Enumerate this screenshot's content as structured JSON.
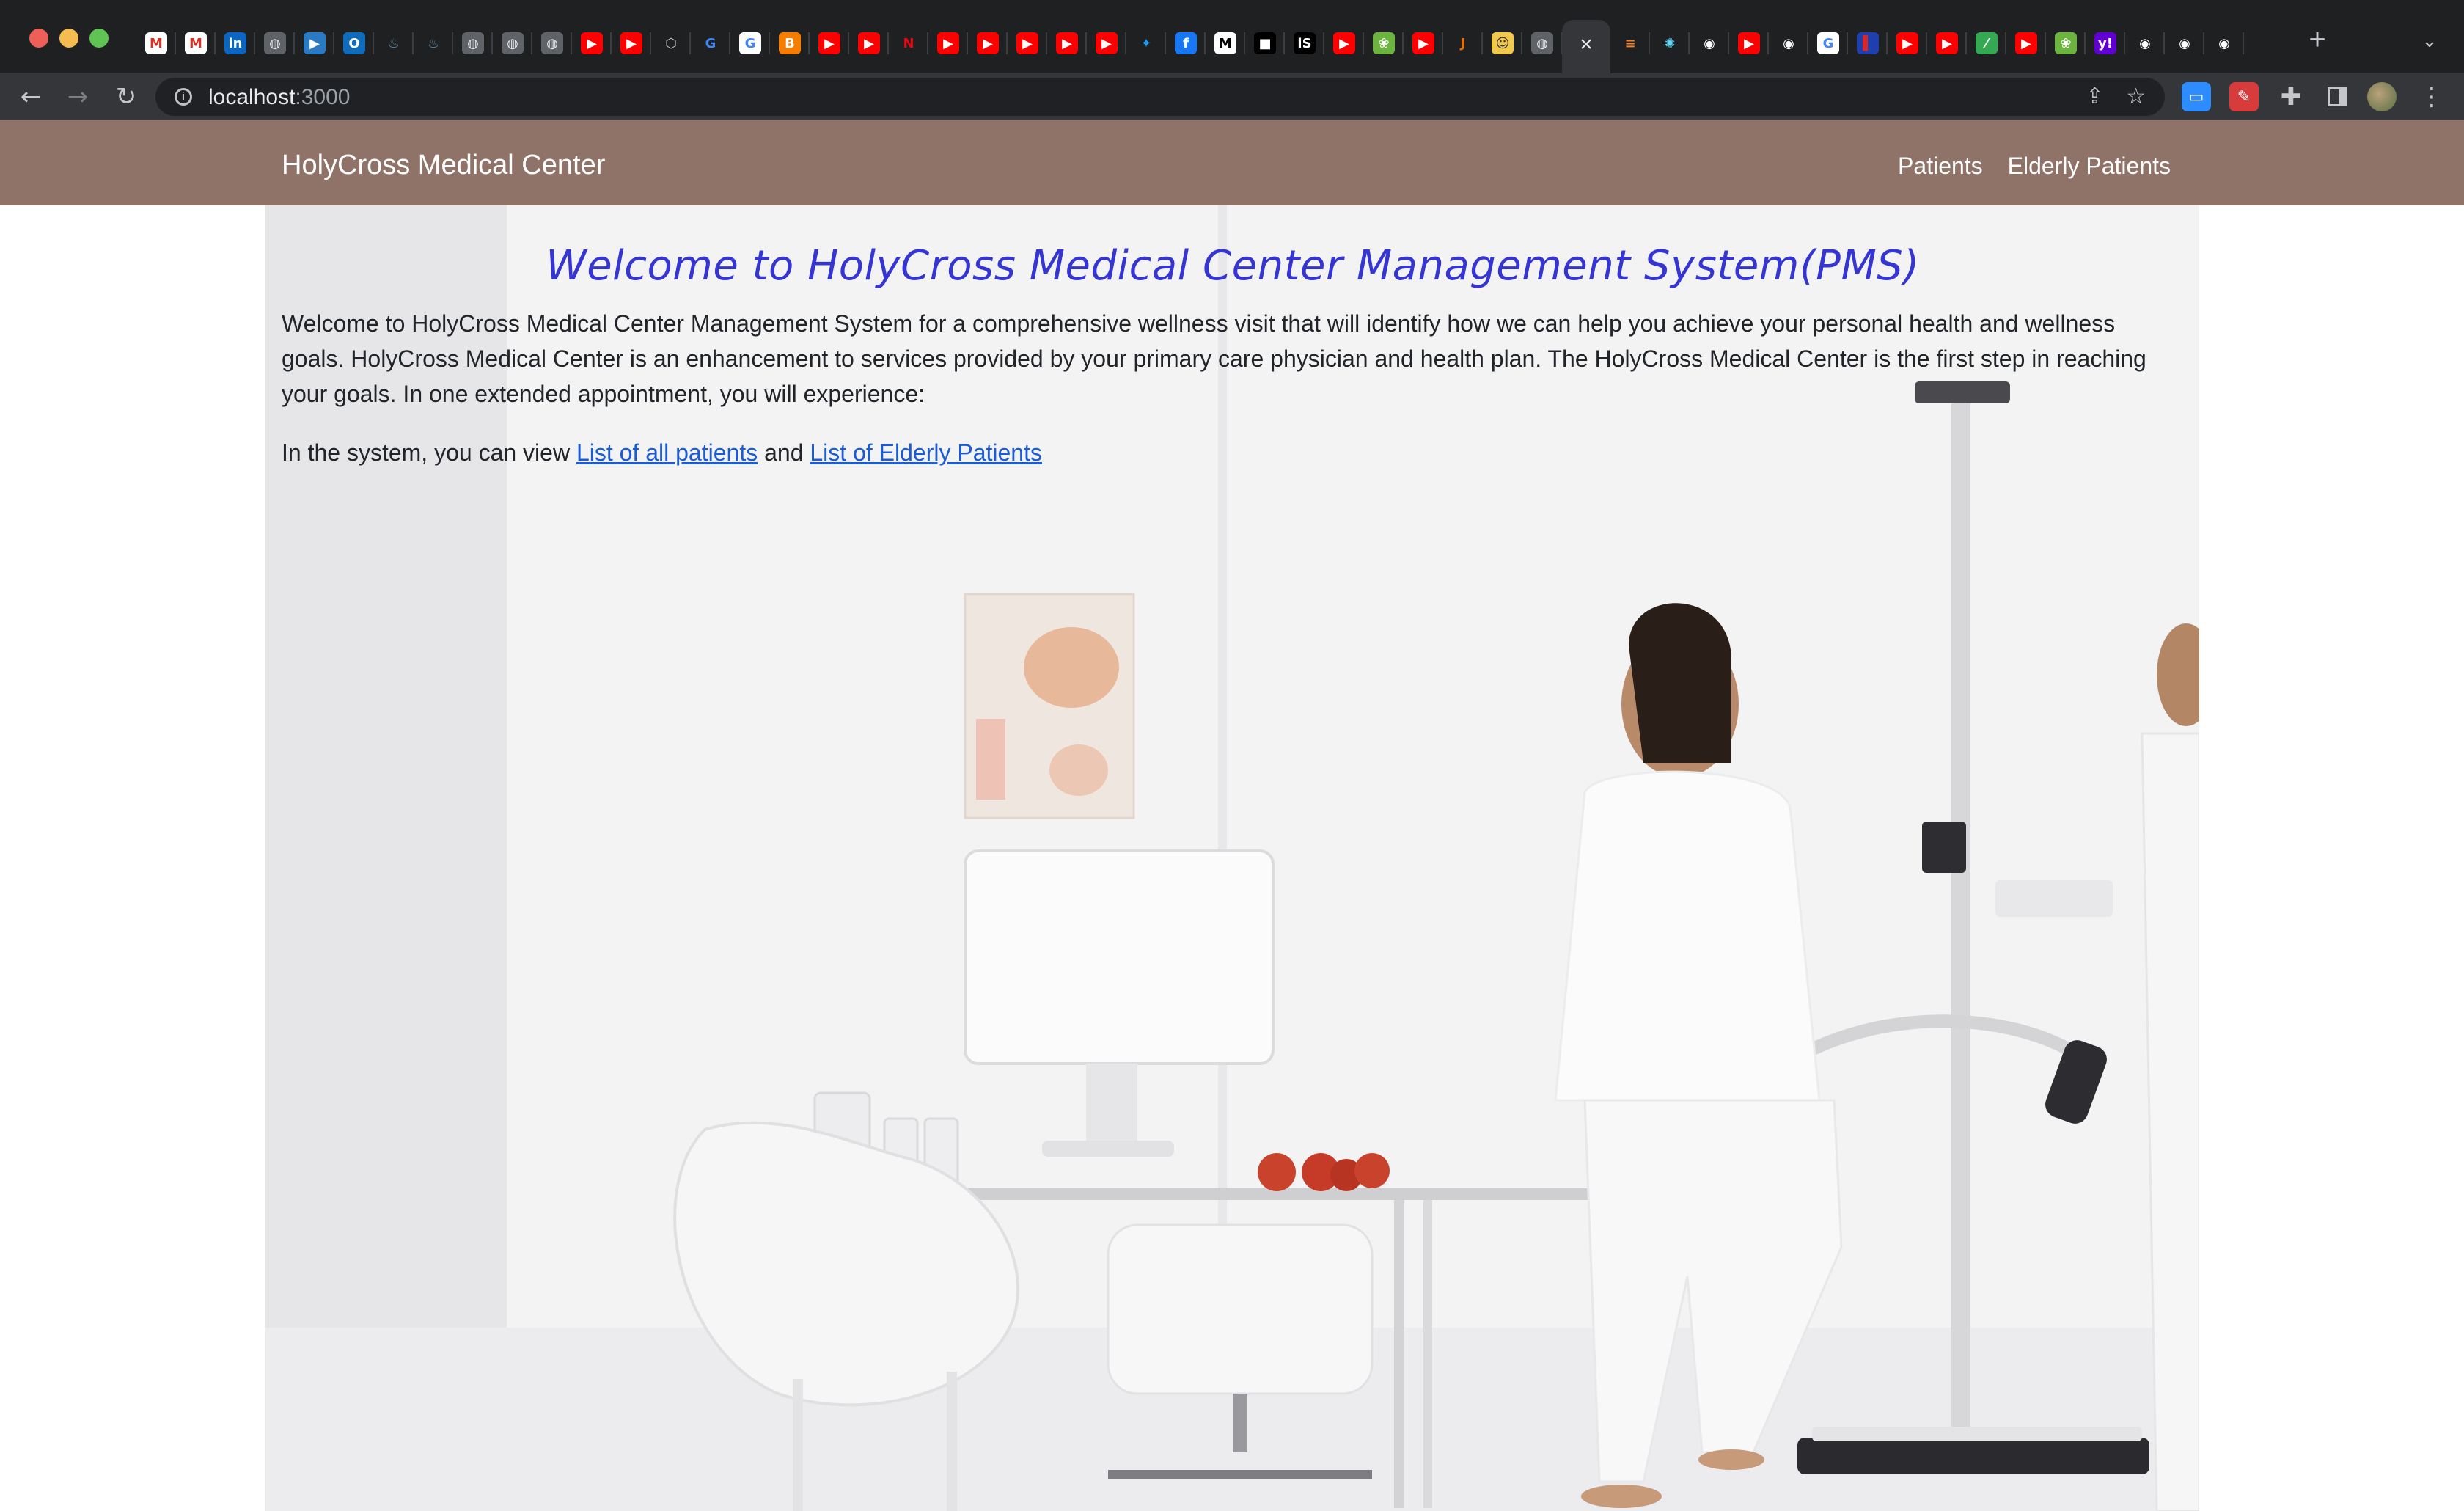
{
  "browser": {
    "url_host": "localhost",
    "url_port": ":3000",
    "colors": {
      "tabstrip": "#1f2022",
      "toolbar": "#35363a",
      "omnibox": "#202124"
    },
    "tab_favicons": [
      {
        "icon": "gmail-icon",
        "bg": "#ffffff",
        "fg": "#d93025",
        "glyph": "M"
      },
      {
        "icon": "gmail-icon",
        "bg": "#ffffff",
        "fg": "#d93025",
        "glyph": "M"
      },
      {
        "icon": "linkedin-icon",
        "bg": "#0a66c2",
        "fg": "#ffffff",
        "glyph": "in"
      },
      {
        "icon": "globe-icon",
        "bg": "#5f6368",
        "fg": "#e8eaed",
        "glyph": "◍"
      },
      {
        "icon": "video-icon",
        "bg": "#2b7bc4",
        "fg": "#ffffff",
        "glyph": "▶"
      },
      {
        "icon": "outlook-icon",
        "bg": "#0f6cbd",
        "fg": "#ffffff",
        "glyph": "O"
      },
      {
        "icon": "java-icon",
        "bg": "#1f2022",
        "fg": "#5382a1",
        "glyph": "♨"
      },
      {
        "icon": "java-icon",
        "bg": "#1f2022",
        "fg": "#5382a1",
        "glyph": "♨"
      },
      {
        "icon": "globe-icon",
        "bg": "#5f6368",
        "fg": "#e8eaed",
        "glyph": "◍"
      },
      {
        "icon": "globe-icon",
        "bg": "#5f6368",
        "fg": "#e8eaed",
        "glyph": "◍"
      },
      {
        "icon": "globe-icon",
        "bg": "#5f6368",
        "fg": "#e8eaed",
        "glyph": "◍"
      },
      {
        "icon": "youtube-icon",
        "bg": "#ff0000",
        "fg": "#ffffff",
        "glyph": "▶"
      },
      {
        "icon": "youtube-icon",
        "bg": "#ff0000",
        "fg": "#ffffff",
        "glyph": "▶"
      },
      {
        "icon": "box-icon",
        "bg": "#1f2022",
        "fg": "#bdbdbd",
        "glyph": "⬡"
      },
      {
        "icon": "google-icon",
        "bg": "#1f2022",
        "fg": "#4285f4",
        "glyph": "G"
      },
      {
        "icon": "google-icon",
        "bg": "#ffffff",
        "fg": "#4285f4",
        "glyph": "G"
      },
      {
        "icon": "blogger-icon",
        "bg": "#f57d00",
        "fg": "#ffffff",
        "glyph": "B"
      },
      {
        "icon": "youtube-icon",
        "bg": "#ff0000",
        "fg": "#ffffff",
        "glyph": "▶"
      },
      {
        "icon": "youtube-icon",
        "bg": "#ff0000",
        "fg": "#ffffff",
        "glyph": "▶"
      },
      {
        "icon": "netflix-icon",
        "bg": "#1f2022",
        "fg": "#e50914",
        "glyph": "N"
      },
      {
        "icon": "youtube-icon",
        "bg": "#ff0000",
        "fg": "#ffffff",
        "glyph": "▶"
      },
      {
        "icon": "youtube-icon",
        "bg": "#ff0000",
        "fg": "#ffffff",
        "glyph": "▶"
      },
      {
        "icon": "youtube-icon",
        "bg": "#ff0000",
        "fg": "#ffffff",
        "glyph": "▶"
      },
      {
        "icon": "youtube-icon",
        "bg": "#ff0000",
        "fg": "#ffffff",
        "glyph": "▶"
      },
      {
        "icon": "youtube-icon",
        "bg": "#ff0000",
        "fg": "#ffffff",
        "glyph": "▶"
      },
      {
        "icon": "twitter-icon",
        "bg": "#1f2022",
        "fg": "#1d9bf0",
        "glyph": "✦"
      },
      {
        "icon": "facebook-icon",
        "bg": "#1877f2",
        "fg": "#ffffff",
        "glyph": "f"
      },
      {
        "icon": "medium-icon",
        "bg": "#ffffff",
        "fg": "#000000",
        "glyph": "M"
      },
      {
        "icon": "dark-icon",
        "bg": "#000000",
        "fg": "#ffffff",
        "glyph": "■"
      },
      {
        "icon": "is-icon",
        "bg": "#000000",
        "fg": "#ffffff",
        "glyph": "iS"
      },
      {
        "icon": "youtube-icon",
        "bg": "#ff0000",
        "fg": "#ffffff",
        "glyph": "▶"
      },
      {
        "icon": "spring-icon",
        "bg": "#6db33f",
        "fg": "#ffffff",
        "glyph": "❀"
      },
      {
        "icon": "youtube-icon",
        "bg": "#ff0000",
        "fg": "#ffffff",
        "glyph": "▶"
      },
      {
        "icon": "java-icon",
        "bg": "#1f2022",
        "fg": "#e76f00",
        "glyph": "J"
      },
      {
        "icon": "emoji-icon",
        "bg": "#f2c94c",
        "fg": "#333333",
        "glyph": "☺"
      },
      {
        "icon": "globe-icon",
        "bg": "#5f6368",
        "fg": "#e8eaed",
        "glyph": "◍"
      }
    ],
    "tab_favicons_after": [
      {
        "icon": "stackoverflow-icon",
        "bg": "#1f2022",
        "fg": "#f48024",
        "glyph": "≡"
      },
      {
        "icon": "react-icon",
        "bg": "#1f2022",
        "fg": "#61dafb",
        "glyph": "✺"
      },
      {
        "icon": "github-icon",
        "bg": "#1f2022",
        "fg": "#ffffff",
        "glyph": "◉"
      },
      {
        "icon": "youtube-icon",
        "bg": "#ff0000",
        "fg": "#ffffff",
        "glyph": "▶"
      },
      {
        "icon": "github-icon",
        "bg": "#1f2022",
        "fg": "#ffffff",
        "glyph": "◉"
      },
      {
        "icon": "google-icon",
        "bg": "#ffffff",
        "fg": "#4285f4",
        "glyph": "G"
      },
      {
        "icon": "flag-icon",
        "bg": "#1e40af",
        "fg": "#dc2626",
        "glyph": "▌"
      },
      {
        "icon": "youtube-icon",
        "bg": "#ff0000",
        "fg": "#ffffff",
        "glyph": "▶"
      },
      {
        "icon": "youtube-icon",
        "bg": "#ff0000",
        "fg": "#ffffff",
        "glyph": "▶"
      },
      {
        "icon": "sheets-icon",
        "bg": "#34a853",
        "fg": "#ffffff",
        "glyph": "⁄"
      },
      {
        "icon": "youtube-icon",
        "bg": "#ff0000",
        "fg": "#ffffff",
        "glyph": "▶"
      },
      {
        "icon": "spring-icon",
        "bg": "#6db33f",
        "fg": "#ffffff",
        "glyph": "❀"
      },
      {
        "icon": "yahoo-icon",
        "bg": "#6001d2",
        "fg": "#ffffff",
        "glyph": "y!"
      },
      {
        "icon": "github-icon",
        "bg": "#1f2022",
        "fg": "#ffffff",
        "glyph": "◉"
      },
      {
        "icon": "github-icon",
        "bg": "#1f2022",
        "fg": "#ffffff",
        "glyph": "◉"
      },
      {
        "icon": "github-icon",
        "bg": "#1f2022",
        "fg": "#ffffff",
        "glyph": "◉"
      }
    ]
  },
  "navbar": {
    "brand": "HolyCross Medical Center",
    "links": [
      "Patients",
      "Elderly Patients"
    ],
    "color": "#8f7368"
  },
  "main": {
    "welcome_title": "Welcome to HolyCross Medical Center Management System(PMS)",
    "intro": "Welcome to HolyCross Medical Center Management System for a comprehensive wellness visit that will identify how we can help you achieve your personal health and wellness goals. HolyCross Medical Center is an enhancement to services provided by your primary care physician and health plan. The HolyCross Medical Center is the first step in reaching your goals. In one extended appointment, you will experience:",
    "links_prefix": "In the system, you can view ",
    "link_all_patients": "List of all patients",
    "links_and": " and ",
    "link_elderly_patients": "List of Elderly Patients",
    "colors": {
      "title": "#3535d4",
      "link": "#1a5cd6",
      "text": "#212529"
    }
  }
}
